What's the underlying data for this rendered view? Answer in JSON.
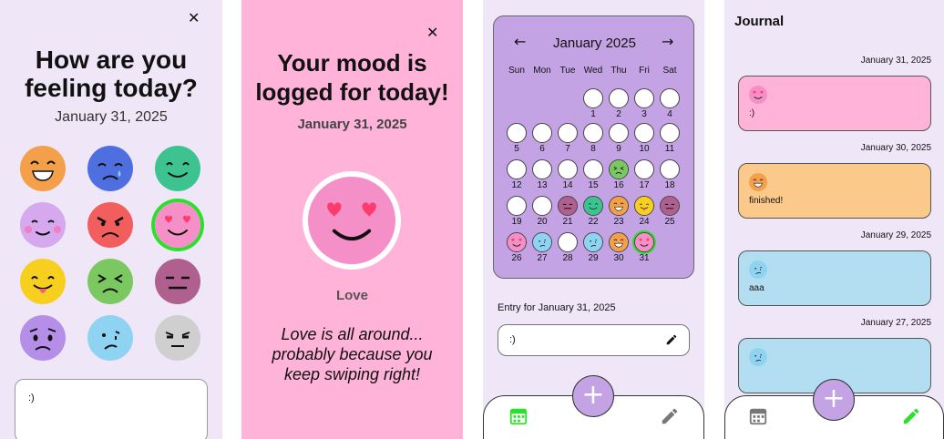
{
  "screen1": {
    "close_label": "✕",
    "question": "How are you feeling today?",
    "date": "January 31, 2025",
    "moods": [
      {
        "icon": "laughing-face-icon",
        "color": "#f4a04b"
      },
      {
        "icon": "crying-face-icon",
        "color": "#4f6fe0"
      },
      {
        "icon": "smiling-face-icon",
        "color": "#3dc38f"
      },
      {
        "icon": "blushing-face-icon",
        "color": "#d6a8ee"
      },
      {
        "icon": "angry-face-icon",
        "color": "#f25e5e"
      },
      {
        "icon": "love-face-icon",
        "color": "#f58fc7",
        "selected": true
      },
      {
        "icon": "tongue-face-icon",
        "color": "#f7cf1f"
      },
      {
        "icon": "squinting-face-icon",
        "color": "#7bc860"
      },
      {
        "icon": "neutral-face-icon",
        "color": "#b0608f"
      },
      {
        "icon": "worried-face-icon",
        "color": "#b58ee8"
      },
      {
        "icon": "sad-face-icon",
        "color": "#8fd3f2"
      },
      {
        "icon": "annoyed-face-icon",
        "color": "#cfcfcf"
      }
    ],
    "note_value": ":)"
  },
  "screen2": {
    "close_label": "✕",
    "title": "Your mood is logged for today!",
    "date": "January 31, 2025",
    "mood_name": "Love",
    "quip": "Love is all around... probably because you keep swiping right!"
  },
  "screen3": {
    "month": "January 2025",
    "prev_label": "←",
    "next_label": "→",
    "weekdays": [
      "Sun",
      "Mon",
      "Tue",
      "Wed",
      "Thu",
      "Fri",
      "Sat"
    ],
    "days": [
      {
        "n": "1"
      },
      {
        "n": "2"
      },
      {
        "n": "3"
      },
      {
        "n": "4"
      },
      {
        "n": "5"
      },
      {
        "n": "6"
      },
      {
        "n": "7"
      },
      {
        "n": "8"
      },
      {
        "n": "9"
      },
      {
        "n": "10"
      },
      {
        "n": "11"
      },
      {
        "n": "12"
      },
      {
        "n": "13"
      },
      {
        "n": "14"
      },
      {
        "n": "15"
      },
      {
        "n": "16",
        "mood": "squinting",
        "color": "#7bc860"
      },
      {
        "n": "17"
      },
      {
        "n": "18"
      },
      {
        "n": "19"
      },
      {
        "n": "20"
      },
      {
        "n": "21",
        "mood": "neutral",
        "color": "#b0608f"
      },
      {
        "n": "22",
        "mood": "smiling",
        "color": "#3dc38f"
      },
      {
        "n": "23",
        "mood": "laughing",
        "color": "#f4a04b"
      },
      {
        "n": "24",
        "mood": "tongue",
        "color": "#f7cf1f"
      },
      {
        "n": "25",
        "mood": "neutral",
        "color": "#b0608f"
      },
      {
        "n": "26",
        "mood": "love",
        "color": "#f58fc7"
      },
      {
        "n": "27",
        "mood": "sad",
        "color": "#8fd3f2"
      },
      {
        "n": "28"
      },
      {
        "n": "29",
        "mood": "sad",
        "color": "#8fd3f2"
      },
      {
        "n": "30",
        "mood": "laughing",
        "color": "#f4a04b"
      },
      {
        "n": "31",
        "mood": "love",
        "color": "#f58fc7",
        "selected": true
      }
    ],
    "entry_label": "Entry for January 31, 2025",
    "entry_value": ":)",
    "fab_label": "+"
  },
  "screen4": {
    "title": "Journal",
    "entries": [
      {
        "date": "January 31, 2025",
        "text": ":)",
        "mood": "love",
        "color": "#ffb3d9",
        "face": "#f58fc7"
      },
      {
        "date": "January 30, 2025",
        "text": "finished!",
        "mood": "laughing",
        "color": "#fbc98a",
        "face": "#f4a04b"
      },
      {
        "date": "January 29, 2025",
        "text": "aaa",
        "mood": "sad",
        "color": "#b3def2",
        "face": "#8fd3f2"
      },
      {
        "date": "January 27, 2025",
        "text": "",
        "mood": "sad",
        "color": "#b3def2",
        "face": "#8fd3f2"
      }
    ],
    "fab_label": "+"
  },
  "colors": {
    "accent": "#c3a3e3",
    "nav_active": "#2be02b",
    "nav_inactive": "#777777"
  }
}
